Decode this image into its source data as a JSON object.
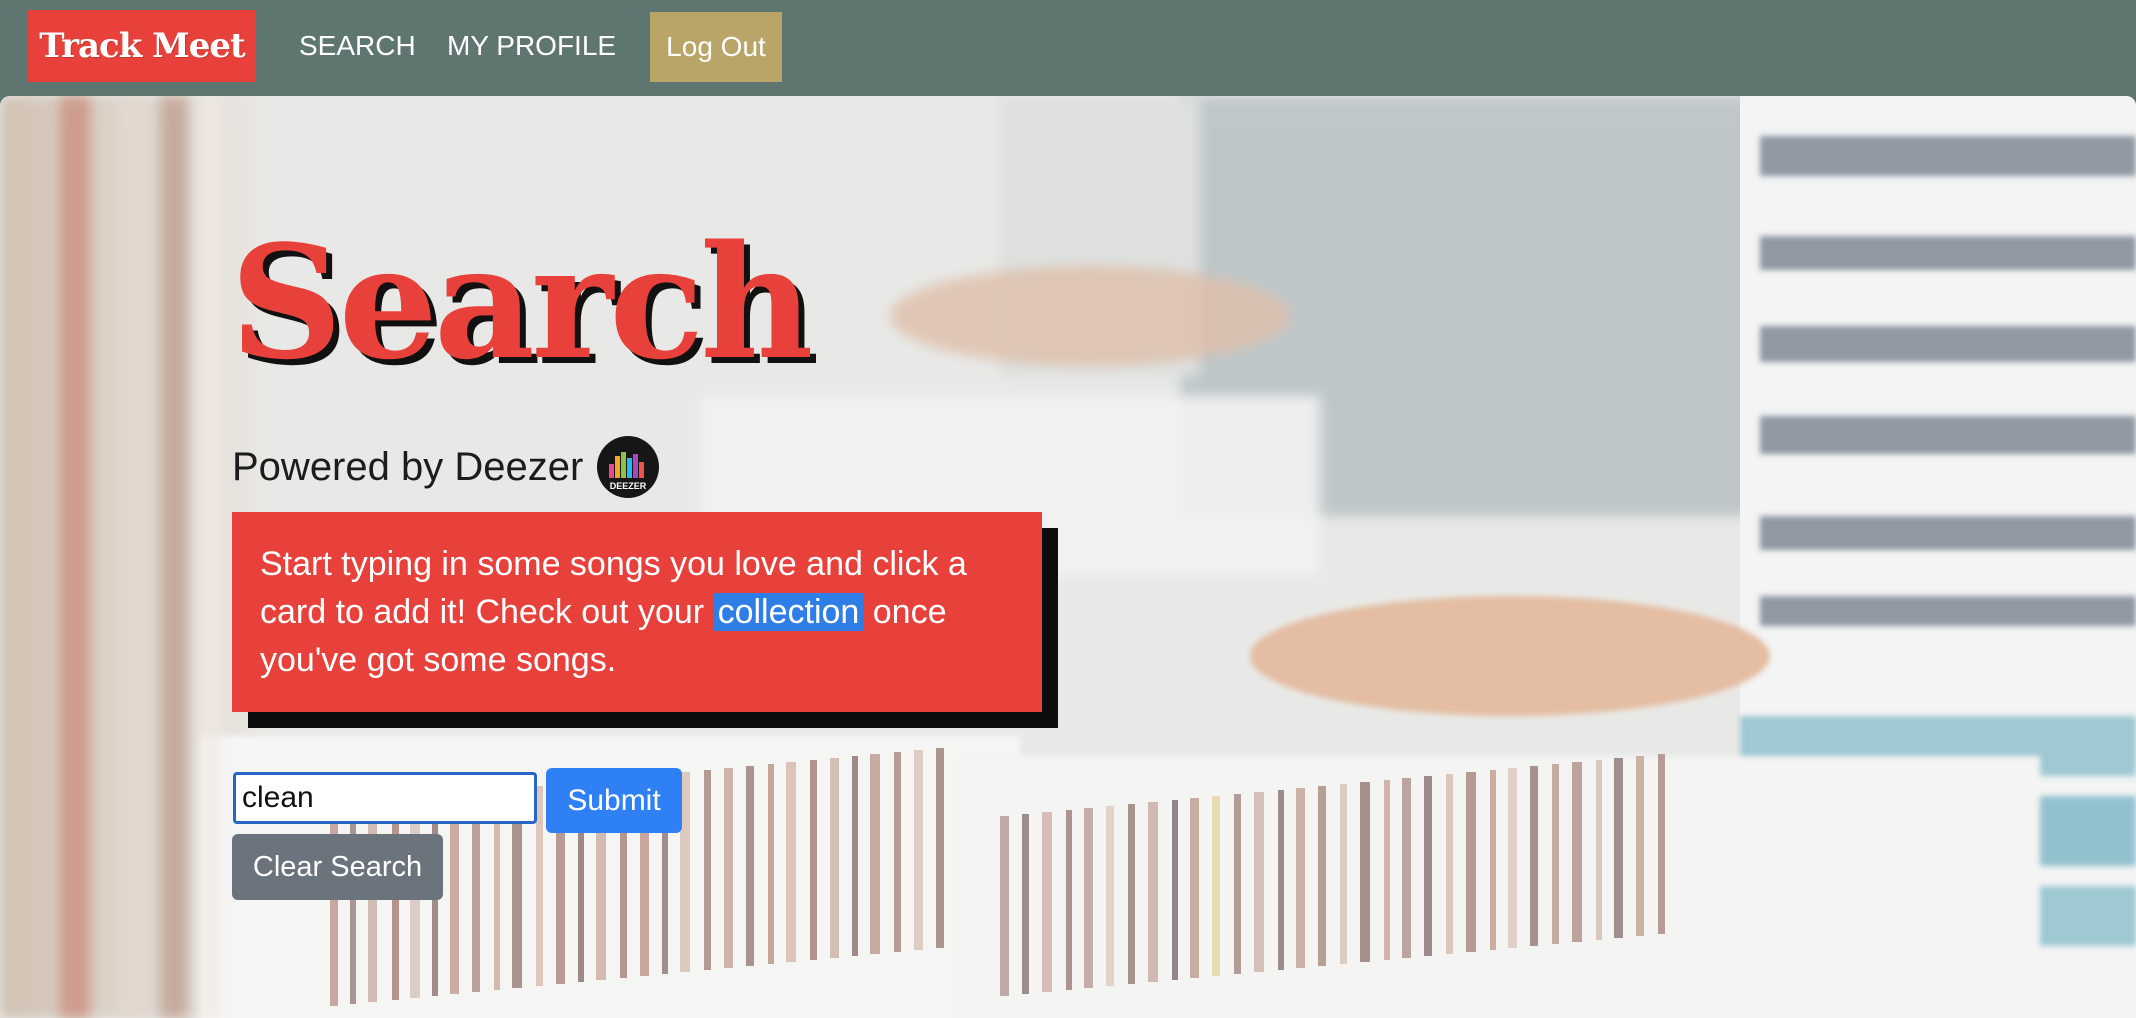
{
  "navbar": {
    "brand": "Track Meet",
    "links": [
      {
        "label": "SEARCH"
      },
      {
        "label": "MY PROFILE"
      }
    ],
    "logout_label": "Log Out"
  },
  "hero": {
    "title": "Search",
    "powered_by": "Powered by Deezer",
    "deezer_logo_text": "DEEZER",
    "instructions": {
      "before": "Start typing in some songs you love and click a card to add it! Check out your ",
      "link": "collection",
      "after": " once you've got some songs."
    }
  },
  "search": {
    "value": "clean",
    "placeholder": "",
    "submit_label": "Submit",
    "clear_label": "Clear Search"
  },
  "colors": {
    "navbar": "#5f756f",
    "brand_red": "#e8403a",
    "logout_gold": "#b9a567",
    "submit_blue": "#2f80f5",
    "clear_gray": "#6b747c",
    "highlight_blue": "#2f7ee8"
  }
}
